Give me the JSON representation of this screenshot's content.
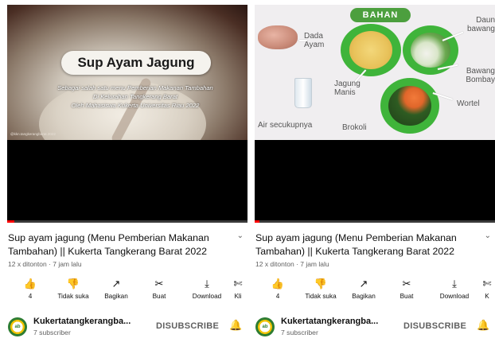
{
  "colors": {
    "progress": "#ff0000",
    "plate_green": "#3fb43a",
    "disubscribe_grey": "#606060"
  },
  "panels": [
    {
      "thumbnail": {
        "heading": "Sup Ayam Jagung",
        "sub_lines": [
          "Sebagai salah satu menu Pemberian Makanan Tambahan",
          "Di Kelurahan Tangkerang Barat",
          "Oleh Mahasiswa Kukerta Universitas Riau 2022"
        ],
        "credit": "@kkn.tangkerangbarat.2022"
      },
      "progress": 0.03,
      "title": "Sup ayam jagung (Menu Pemberian Makanan Tambahan) || Kukerta Tangkerang Barat 2022",
      "meta": "12 x ditonton · 7 jam lalu",
      "actions": [
        {
          "icon": "like-icon",
          "glyph": "👍",
          "label": "4"
        },
        {
          "icon": "dislike-icon",
          "glyph": "👎",
          "label": "Tidak suka"
        },
        {
          "icon": "share-icon",
          "glyph": "↗",
          "label": "Bagikan"
        },
        {
          "icon": "create-icon",
          "glyph": "✂",
          "label": "Buat"
        },
        {
          "icon": "download-icon",
          "glyph": "⤓",
          "label": "Download"
        },
        {
          "icon": "clip-icon",
          "glyph": "✄",
          "label": "Kli"
        }
      ],
      "channel": {
        "avatar_text": "ab",
        "name": "Kukertatangkerangba...",
        "subscribers": "7 subscriber",
        "subscribe_label": "DISUBSCRIBE"
      }
    },
    {
      "thumbnail": {
        "heading": "BAHAN",
        "labels": [
          "Dada Ayam",
          "Daun bawang",
          "Air secukupnya",
          "Jagung Manis",
          "Bawang Bombay",
          "Wortel",
          "Brokoli"
        ]
      },
      "progress": 0.02,
      "title": "Sup ayam jagung (Menu Pemberian Makanan Tambahan) || Kukerta Tangkerang Barat 2022",
      "meta": "12 x ditonton · 7 jam lalu",
      "actions": [
        {
          "icon": "like-icon",
          "glyph": "👍",
          "label": "4"
        },
        {
          "icon": "dislike-icon",
          "glyph": "👎",
          "label": "Tidak suka"
        },
        {
          "icon": "share-icon",
          "glyph": "↗",
          "label": "Bagikan"
        },
        {
          "icon": "create-icon",
          "glyph": "✂",
          "label": "Buat"
        },
        {
          "icon": "download-icon",
          "glyph": "⤓",
          "label": "Download"
        },
        {
          "icon": "clip-icon",
          "glyph": "✄",
          "label": "K"
        }
      ],
      "channel": {
        "avatar_text": "ab",
        "name": "Kukertatangkerangba...",
        "subscribers": "7 subscriber",
        "subscribe_label": "DISUBSCRIBE"
      }
    }
  ]
}
